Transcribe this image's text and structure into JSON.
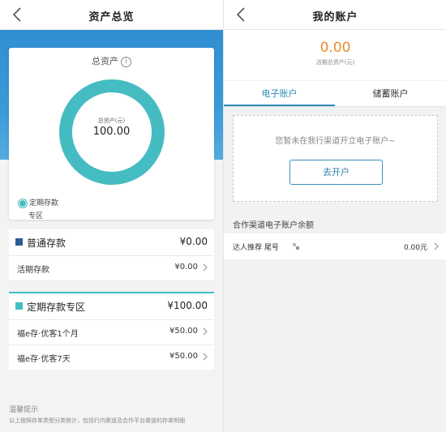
{
  "left": {
    "title": "资产总览",
    "card": {
      "title": "总资产",
      "info_icon": "info-icon",
      "donut_label": "总资产(元)",
      "donut_value": "100.00",
      "legend_label": "定期存款",
      "legend_sub": "专区",
      "legend_color": "#45bcc1"
    },
    "sections": [
      {
        "name": "普通存款",
        "amount": "¥0.00",
        "color": "#2a5d97",
        "rows": [
          {
            "name": "活期存款",
            "amount": "¥0.00"
          }
        ]
      },
      {
        "name": "定期存款专区",
        "amount": "¥100.00",
        "color": "#45bcc1",
        "rows": [
          {
            "name": "福e存·优客1个月",
            "amount": "¥50.00"
          },
          {
            "name": "福e存·优客7天",
            "amount": "¥50.00"
          }
        ]
      }
    ],
    "tip_title": "温馨提示",
    "tip_text": "以上按照存单类型分类统计，包括行内渠道及合作平台渠道的存单明细"
  },
  "right": {
    "title": "我的账户",
    "balance_value": "0.00",
    "balance_label": "活期总资产(元)",
    "tabs": [
      {
        "label": "电子账户",
        "active": true
      },
      {
        "label": "储蓄账户",
        "active": false
      }
    ],
    "empty_message": "您暂未在我行渠道开立电子账户~",
    "open_button": "去开户",
    "partner_heading": "合作渠道电子账户余额",
    "partner_row": {
      "name": "达人推荐 尾号",
      "amount": "0.00元"
    },
    "accent": "#2b8ab8",
    "balance_color": "#ec8a2b"
  }
}
